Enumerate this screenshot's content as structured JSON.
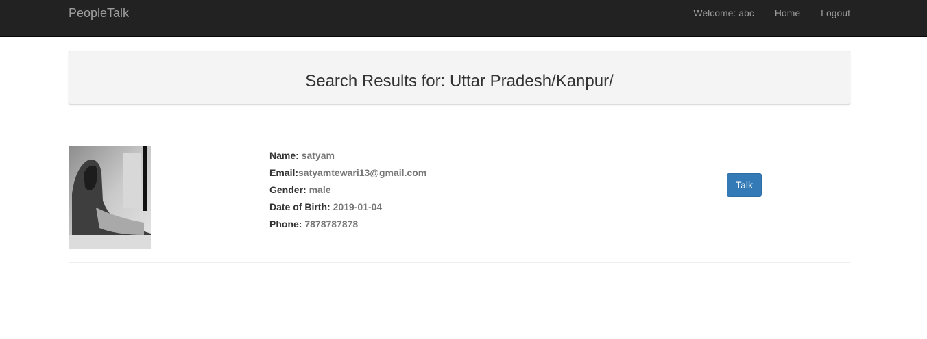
{
  "navbar": {
    "brand": "PeopleTalk",
    "welcome": "Welcome: abc",
    "home_label": "Home",
    "logout_label": "Logout"
  },
  "search": {
    "heading": "Search Results for: Uttar Pradesh/Kanpur/"
  },
  "result": {
    "name_label": "Name:",
    "name": "satyam",
    "email_label": "Email:",
    "email": "satyamtewari13@gmail.com",
    "gender_label": "Gender:",
    "gender": "male",
    "dob_label": "Date of Birth:",
    "dob": "2019-01-04",
    "phone_label": "Phone:",
    "phone": "7878787878",
    "talk_label": "Talk"
  },
  "colors": {
    "navbar_bg": "#222222",
    "nav_text": "#9d9d9d",
    "button_primary": "#337ab7"
  }
}
